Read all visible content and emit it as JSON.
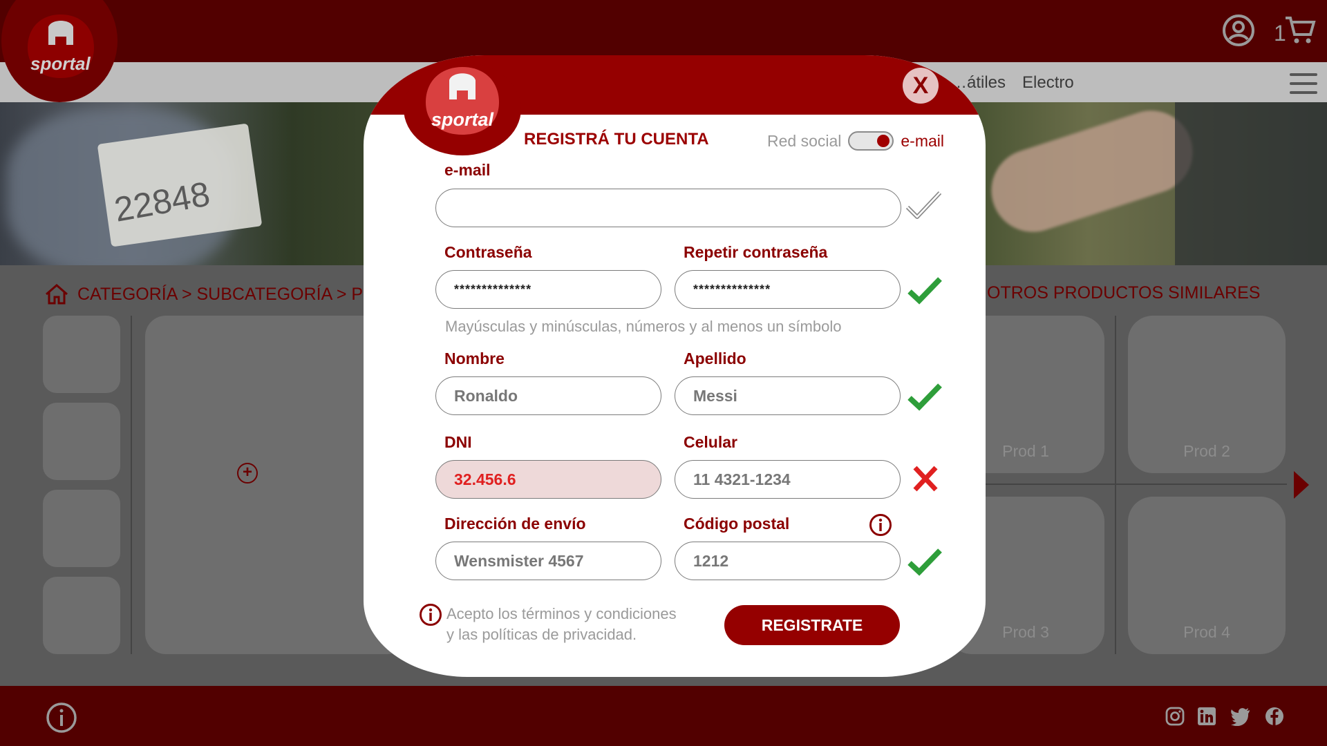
{
  "brand": {
    "logo_text": "sportal"
  },
  "header": {
    "nav_items": [
      "…átiles",
      "Electro"
    ],
    "cart_count": "1"
  },
  "breadcrumb": {
    "text": "CATEGORÍA > SUBCATEGORÍA > PR"
  },
  "hero": {
    "bib_number": "22848"
  },
  "similar": {
    "title": "OTROS PRODUCTOS SIMILARES",
    "products": [
      "Prod 1",
      "Prod 2",
      "Prod 3",
      "Prod 4"
    ]
  },
  "modal": {
    "title": "REGISTRÁ TU CUENTA",
    "close_label": "X",
    "toggle": {
      "left": "Red social",
      "right": "e-mail",
      "active": "e-mail"
    },
    "email": {
      "label": "e-mail",
      "value": ""
    },
    "password": {
      "label": "Contraseña",
      "value": "**************"
    },
    "password_repeat": {
      "label": "Repetir contraseña",
      "value": "**************"
    },
    "password_hint": "Mayúsculas y minúsculas, números y al menos un símbolo",
    "first_name": {
      "label": "Nombre",
      "value": "Ronaldo"
    },
    "last_name": {
      "label": "Apellido",
      "value": "Messi"
    },
    "dni": {
      "label": "DNI",
      "value": "32.456.6",
      "state": "error"
    },
    "phone": {
      "label": "Celular",
      "value": "11 4321-1234"
    },
    "address": {
      "label": "Dirección de envío",
      "value": "Wensmister 4567"
    },
    "postal": {
      "label": "Código postal",
      "value": "1212"
    },
    "terms": {
      "line1": "Acepto los términos y condiciones",
      "line2": "y las políticas de privacidad."
    },
    "submit_label": "REGISTRATE"
  },
  "colors": {
    "brand_dark": "#520000",
    "brand": "#950000",
    "ok": "#2e9e3a",
    "error": "#e02020"
  }
}
